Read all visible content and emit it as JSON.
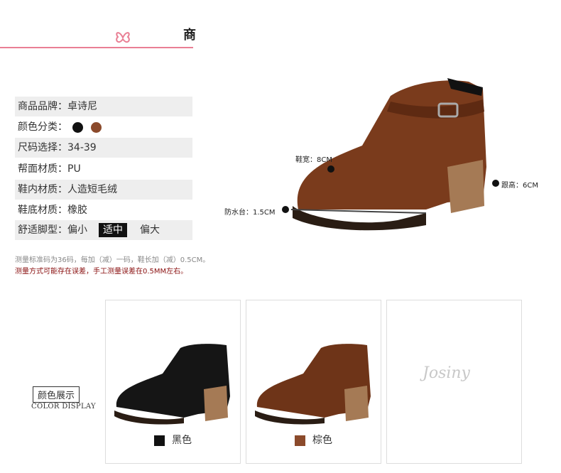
{
  "header": {
    "title_fragment": "商"
  },
  "specs": [
    {
      "label": "商品品牌：卓诗尼"
    },
    {
      "label": "颜色分类："
    },
    {
      "label": "尺码选择：34-39"
    },
    {
      "label": "帮面材质：PU"
    },
    {
      "label": "鞋内材质：人造短毛绒"
    },
    {
      "label": "鞋底材质：橡胶"
    },
    {
      "label": "舒适脚型：偏小",
      "mid": "适中",
      "right": "偏大"
    }
  ],
  "color_dots": [
    "#111111",
    "#8b4a2b"
  ],
  "notes": {
    "line1": "测量标准码为36码，每加（减）一码，鞋长加（减）0.5CM。",
    "line2": "测量方式可能存在误差，手工测量误差在0.5MM左右。"
  },
  "measurements": {
    "width": "鞋宽：8CM",
    "heel": "跟高：6CM",
    "platform": "防水台：1.5CM"
  },
  "color_display": {
    "title": "颜色展示",
    "subtitle": "COLOR DISPLAY"
  },
  "swatches": [
    {
      "name": "黑色",
      "color": "#111111"
    },
    {
      "name": "棕色",
      "color": "#8b4a2b"
    }
  ],
  "watermark": {
    "logo": "Josiny"
  }
}
